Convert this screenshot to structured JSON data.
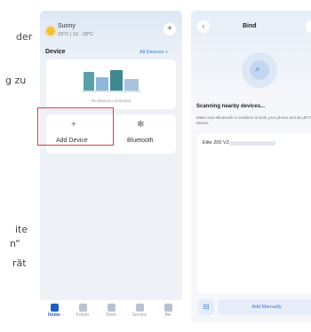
{
  "doc": {
    "frag_a": "der",
    "frag_b": "g zu",
    "frag_c": "ite",
    "frag_d": "n“",
    "frag_e": "rät"
  },
  "home": {
    "weather": "Sunny",
    "temp": "23°C | 12 - 28°C",
    "device_label": "Device",
    "all_devices": "All Devices >",
    "no_devices": "No devices connected",
    "add_device": "Add Device",
    "bluetooth": "Bluetooth",
    "tabs": [
      "Home",
      "Forum",
      "Store",
      "Service",
      "Me"
    ]
  },
  "bind": {
    "title": "Bind",
    "scanning": "Scanning nearby devices...",
    "desc": "Make sure Bluetooth is enabled on both your phone and BLUETTI device.",
    "device_name": "Elite 200 V2",
    "add_manually": "Add Manually"
  },
  "colors": {
    "accent": "#3a7bd5",
    "highlight": "#e0393e"
  }
}
